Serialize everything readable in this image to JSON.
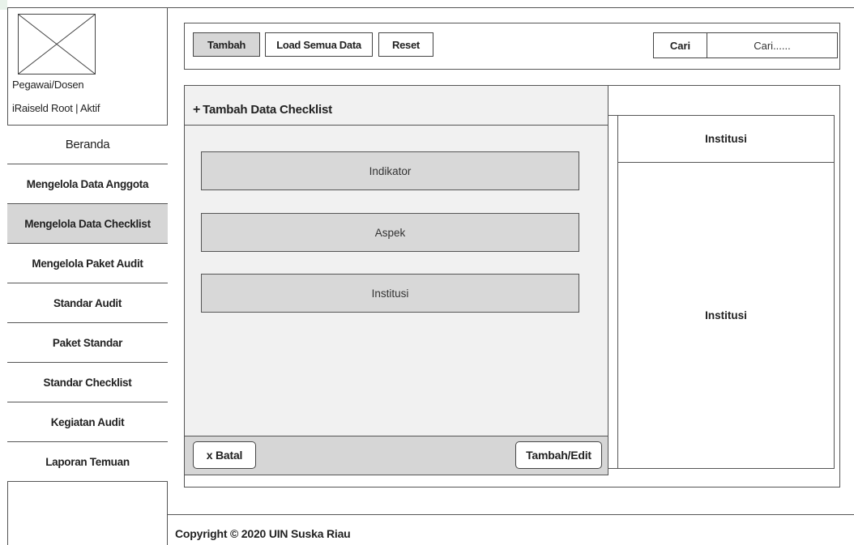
{
  "sidebar": {
    "user_role": "Pegawai/Dosen",
    "user_status": "iRaiseld Root  |  Aktif",
    "items": [
      {
        "label": "Beranda"
      },
      {
        "label": "Mengelola Data Anggota"
      },
      {
        "label": "Mengelola Data Checklist"
      },
      {
        "label": "Mengelola Paket Audit"
      },
      {
        "label": "Standar Audit"
      },
      {
        "label": "Paket Standar"
      },
      {
        "label": "Standar Checklist"
      },
      {
        "label": "Kegiatan Audit"
      },
      {
        "label": "Laporan Temuan"
      }
    ]
  },
  "toolbar": {
    "add_label": "Tambah",
    "load_label": "Load Semua Data",
    "reset_label": "Reset",
    "search_label": "Cari",
    "search_placeholder": "Cari......"
  },
  "table": {
    "header": "Institusi",
    "cell": "Institusi"
  },
  "modal": {
    "title": "Tambah Data Checklist",
    "plus_icon": "+",
    "fields": {
      "indikator": "Indikator",
      "aspek": "Aspek",
      "institusi": "Institusi"
    },
    "cancel_label": "x Batal",
    "save_label": "Tambah/Edit"
  },
  "footer": {
    "copyright": "Copyright © 2020 UIN Suska Riau"
  },
  "colors": {
    "border": "#555555",
    "active": "#d6d6d6",
    "modal_bg": "#f1f1f1",
    "field_bg": "#d8d8d8"
  }
}
